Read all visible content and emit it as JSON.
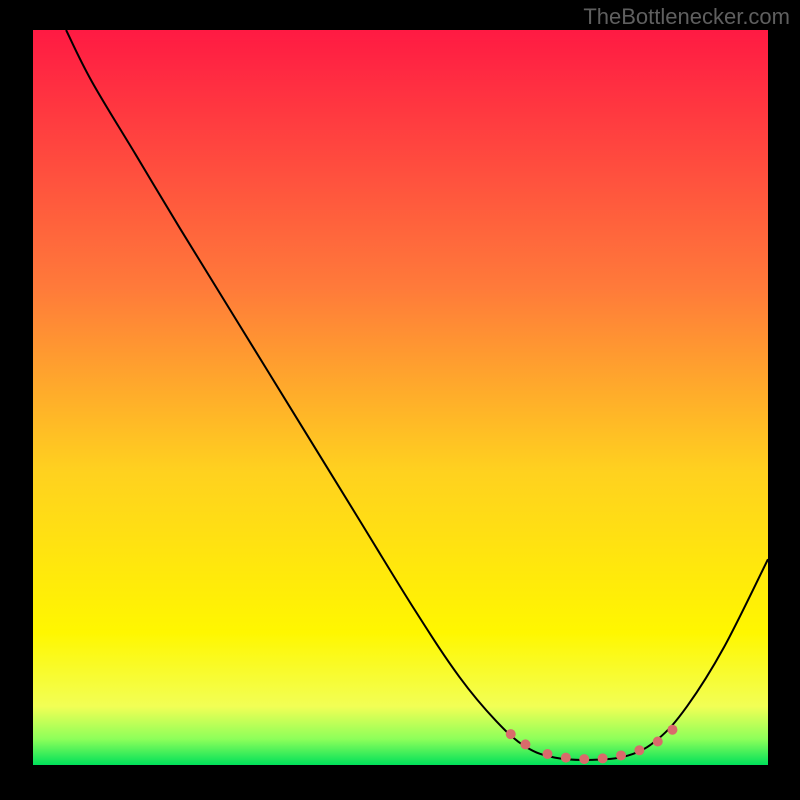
{
  "watermark": "TheBottlenecker.com",
  "chart_data": {
    "type": "line",
    "title": "",
    "xlabel": "",
    "ylabel": "",
    "xlim": [
      0,
      100
    ],
    "ylim": [
      0,
      100
    ],
    "background_gradient": {
      "stops": [
        {
          "offset": 0.0,
          "color": "#ff1a43"
        },
        {
          "offset": 0.35,
          "color": "#ff7a3a"
        },
        {
          "offset": 0.6,
          "color": "#ffd11f"
        },
        {
          "offset": 0.82,
          "color": "#fff700"
        },
        {
          "offset": 0.92,
          "color": "#f2ff55"
        },
        {
          "offset": 0.965,
          "color": "#8cff5a"
        },
        {
          "offset": 1.0,
          "color": "#00e05a"
        }
      ]
    },
    "series": [
      {
        "name": "curve",
        "color": "#000000",
        "stroke_width": 2,
        "points": [
          {
            "x": 4.5,
            "y": 100
          },
          {
            "x": 8,
            "y": 93
          },
          {
            "x": 14,
            "y": 83
          },
          {
            "x": 20,
            "y": 73
          },
          {
            "x": 28,
            "y": 60
          },
          {
            "x": 36,
            "y": 47
          },
          {
            "x": 44,
            "y": 34
          },
          {
            "x": 52,
            "y": 21
          },
          {
            "x": 58,
            "y": 12
          },
          {
            "x": 63,
            "y": 6
          },
          {
            "x": 67,
            "y": 2.5
          },
          {
            "x": 71,
            "y": 1
          },
          {
            "x": 76,
            "y": 0.7
          },
          {
            "x": 81,
            "y": 1.3
          },
          {
            "x": 85,
            "y": 3.5
          },
          {
            "x": 89,
            "y": 8
          },
          {
            "x": 94,
            "y": 16
          },
          {
            "x": 100,
            "y": 28
          }
        ]
      },
      {
        "name": "markers",
        "color": "#d96b6b",
        "marker_radius": 5,
        "points": [
          {
            "x": 65,
            "y": 4.2
          },
          {
            "x": 67,
            "y": 2.8
          },
          {
            "x": 70,
            "y": 1.5
          },
          {
            "x": 72.5,
            "y": 1.0
          },
          {
            "x": 75,
            "y": 0.8
          },
          {
            "x": 77.5,
            "y": 0.9
          },
          {
            "x": 80,
            "y": 1.3
          },
          {
            "x": 82.5,
            "y": 2.0
          },
          {
            "x": 85,
            "y": 3.2
          },
          {
            "x": 87,
            "y": 4.8
          }
        ]
      }
    ]
  }
}
